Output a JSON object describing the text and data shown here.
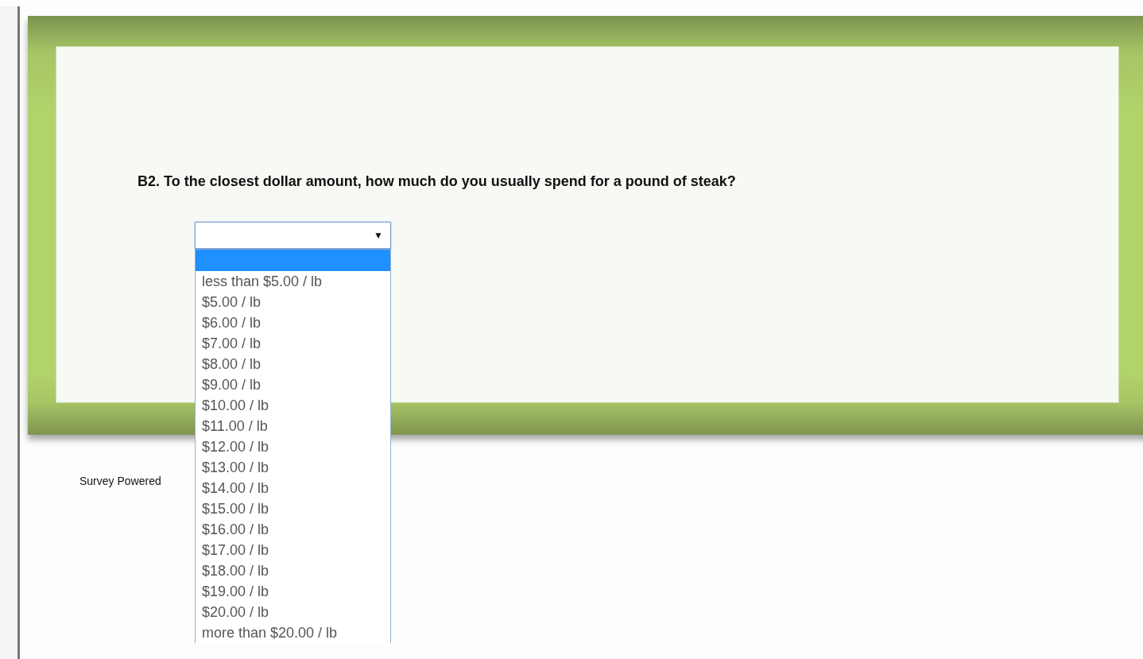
{
  "question": {
    "text": "B2. To the closest dollar amount, how much do you usually spend for a pound of steak?"
  },
  "select": {
    "expanded": true,
    "caret": "▼"
  },
  "options": [
    {
      "kind": "blank",
      "selected": true
    },
    {
      "kind": "text",
      "label": "less than $5.00 / lb",
      "selected": false
    },
    {
      "kind": "text",
      "label": "$5.00 / lb",
      "selected": false
    },
    {
      "kind": "text",
      "label": "$6.00 / lb",
      "selected": false
    },
    {
      "kind": "text",
      "label": "$7.00 / lb",
      "selected": false
    },
    {
      "kind": "text",
      "label": "$8.00 / lb",
      "selected": false
    },
    {
      "kind": "text",
      "label": "$9.00 / lb",
      "selected": false
    },
    {
      "kind": "text",
      "label": "$10.00 / lb",
      "selected": false
    },
    {
      "kind": "text",
      "label": "$11.00 / lb",
      "selected": false
    },
    {
      "kind": "text",
      "label": "$12.00 / lb",
      "selected": false
    },
    {
      "kind": "text",
      "label": "$13.00 / lb",
      "selected": false
    },
    {
      "kind": "text",
      "label": "$14.00 / lb",
      "selected": false
    },
    {
      "kind": "text",
      "label": "$15.00 / lb",
      "selected": false
    },
    {
      "kind": "text",
      "label": "$16.00 / lb",
      "selected": false
    },
    {
      "kind": "text",
      "label": "$17.00 / lb",
      "selected": false
    },
    {
      "kind": "text",
      "label": "$18.00 / lb",
      "selected": false
    },
    {
      "kind": "text",
      "label": "$19.00 / lb",
      "selected": false
    },
    {
      "kind": "text",
      "label": "$20.00 / lb",
      "selected": false
    },
    {
      "kind": "text",
      "label": "more than $20.00 / lb",
      "selected": false
    }
  ],
  "footer": {
    "text": "Survey Powered"
  }
}
